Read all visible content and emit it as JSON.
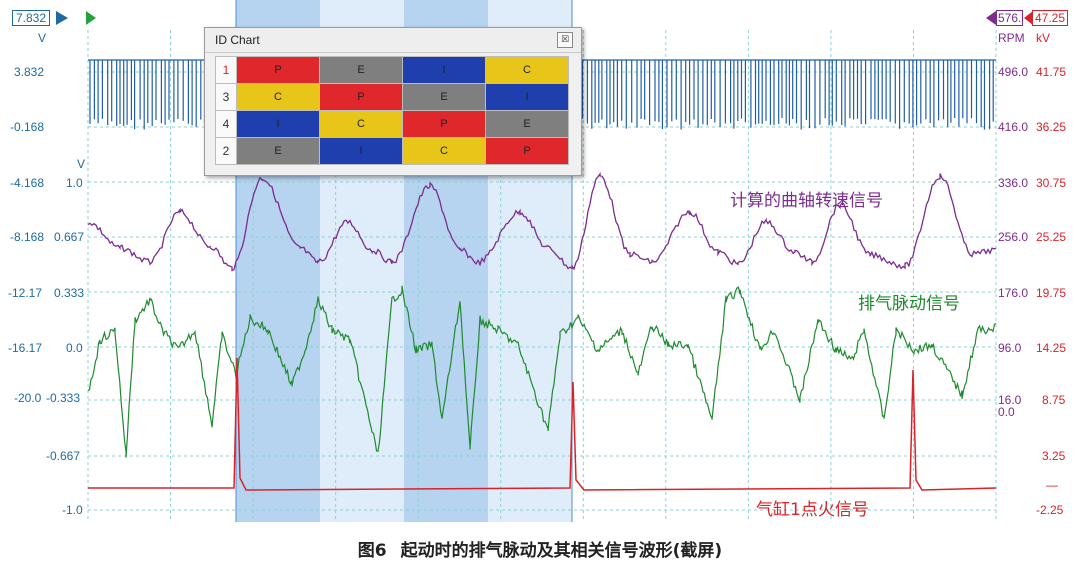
{
  "top_left_badge": "7.832",
  "top_left_unit": "V",
  "top_right_badge_rpm": "576.",
  "top_right_badge_kv": "47.25",
  "right_units": {
    "rpm": "RPM",
    "kv": "kV"
  },
  "left_axis_outer": [
    "3.832",
    "-0.168",
    "-4.168",
    "-8.168",
    "-12.17",
    "-16.17",
    "-20.0"
  ],
  "left_axis_inner_unit": "V",
  "left_axis_inner": [
    "1.0",
    "0.667",
    "0.333",
    "0.0",
    "-0.333",
    "-0.667",
    "-1.0"
  ],
  "right_axis_rpm": [
    "496.0",
    "416.0",
    "336.0",
    "256.0",
    "176.0",
    "96.0",
    "16.0",
    "0.0"
  ],
  "right_axis_kv": [
    "41.75",
    "36.25",
    "30.75",
    "25.25",
    "19.75",
    "14.25",
    "8.75",
    "3.25",
    "—",
    "-2.25"
  ],
  "trace_labels": {
    "crank_speed": "计算的曲轴转速信号",
    "exhaust_pulse": "排气脉动信号",
    "ignition": "气缸1点火信号"
  },
  "colors": {
    "blue_trace": "#1f5fa8",
    "purple_trace": "#7b2c8e",
    "green_trace": "#1e8a2e",
    "red_trace": "#d8232a",
    "highlight_dark": "#a9cbec",
    "highlight_light": "#d9e9f8",
    "grid": "#8fd0d3"
  },
  "id_chart": {
    "title": "ID Chart",
    "close_icon": "close-icon",
    "rows": [
      {
        "id": "1",
        "id_color": "#d8232a",
        "cells": [
          {
            "label": "P",
            "color": "#e0282c"
          },
          {
            "label": "E",
            "color": "#7f7f7f"
          },
          {
            "label": "I",
            "color": "#1f3fae"
          },
          {
            "label": "C",
            "color": "#e8c619"
          }
        ]
      },
      {
        "id": "3",
        "id_color": "#333333",
        "cells": [
          {
            "label": "C",
            "color": "#e8c619"
          },
          {
            "label": "P",
            "color": "#e0282c"
          },
          {
            "label": "E",
            "color": "#7f7f7f"
          },
          {
            "label": "I",
            "color": "#1f3fae"
          }
        ]
      },
      {
        "id": "4",
        "id_color": "#333333",
        "cells": [
          {
            "label": "I",
            "color": "#1f3fae"
          },
          {
            "label": "C",
            "color": "#e8c619"
          },
          {
            "label": "P",
            "color": "#e0282c"
          },
          {
            "label": "E",
            "color": "#7f7f7f"
          }
        ]
      },
      {
        "id": "2",
        "id_color": "#333333",
        "cells": [
          {
            "label": "E",
            "color": "#7f7f7f"
          },
          {
            "label": "I",
            "color": "#1f3fae"
          },
          {
            "label": "C",
            "color": "#e8c619"
          },
          {
            "label": "P",
            "color": "#e0282c"
          }
        ]
      }
    ]
  },
  "caption_number": "图6",
  "caption_text": "起动时的排气脉动及其相关信号波形(截屏)"
}
